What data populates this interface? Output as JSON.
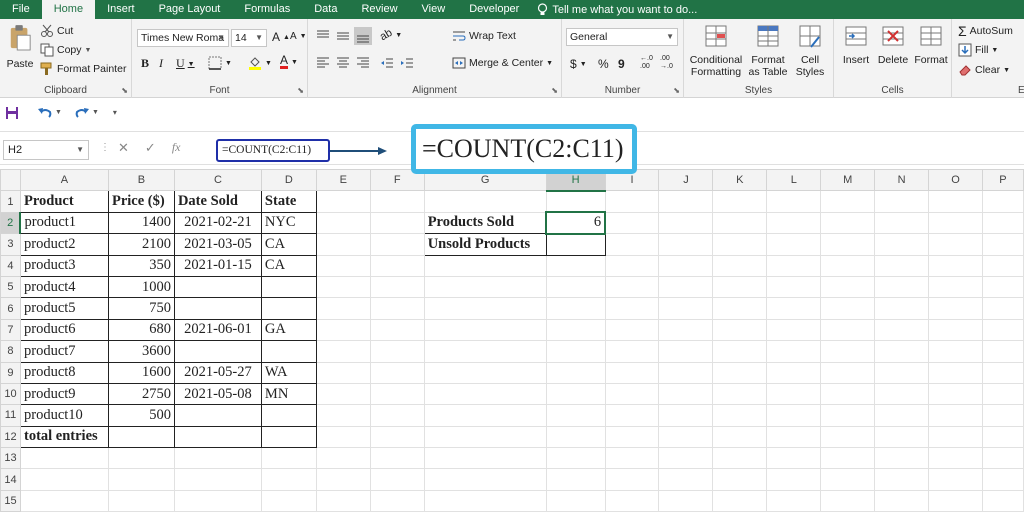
{
  "menu": {
    "tabs": [
      "File",
      "Home",
      "Insert",
      "Page Layout",
      "Formulas",
      "Data",
      "Review",
      "View",
      "Developer"
    ],
    "active": "Home",
    "tell_me": "Tell me what you want to do..."
  },
  "ribbon": {
    "clipboard": {
      "label": "Clipboard",
      "paste": "Paste",
      "cut": "Cut",
      "copy": "Copy",
      "format_painter": "Format Painter"
    },
    "font": {
      "label": "Font",
      "font_name": "Times New Roma",
      "font_size": "14",
      "bold": "B",
      "italic": "I",
      "underline": "U"
    },
    "alignment": {
      "label": "Alignment",
      "wrap_text": "Wrap Text",
      "merge_center": "Merge & Center"
    },
    "number": {
      "label": "Number",
      "format": "General",
      "currency": "$",
      "percent": "%",
      "comma": "9"
    },
    "styles": {
      "label": "Styles",
      "conditional_formatting": "Conditional Formatting",
      "format_as_table": "Format as Table",
      "cell_styles": "Cell Styles"
    },
    "cells": {
      "label": "Cells",
      "insert": "Insert",
      "delete": "Delete",
      "format": "Format"
    },
    "editing": {
      "label": "Ed",
      "autosum": "AutoSum",
      "fill": "Fill",
      "clear": "Clear"
    }
  },
  "formula_bar": {
    "name_box": "H2",
    "formula": "=COUNT(C2:C11)",
    "callout": "=COUNT(C2:C11)"
  },
  "sheet": {
    "columns": [
      "A",
      "B",
      "C",
      "D",
      "E",
      "F",
      "G",
      "H",
      "I",
      "J",
      "K",
      "L",
      "M",
      "N",
      "O",
      "P"
    ],
    "selected_column": "H",
    "selected_row": 2,
    "rows": [
      [
        "Product",
        "Price ($)",
        "Date Sold",
        "State",
        "",
        "",
        "",
        ""
      ],
      [
        "product1",
        "1400",
        "2021-02-21",
        "NYC",
        "",
        "",
        "Products Sold",
        "6"
      ],
      [
        "product2",
        "2100",
        "2021-03-05",
        "CA",
        "",
        "",
        "Unsold Products",
        ""
      ],
      [
        "product3",
        "350",
        "2021-01-15",
        "CA",
        "",
        "",
        "",
        ""
      ],
      [
        "product4",
        "1000",
        "",
        "",
        "",
        "",
        "",
        ""
      ],
      [
        "product5",
        "750",
        "",
        "",
        "",
        "",
        "",
        ""
      ],
      [
        "product6",
        "680",
        "2021-06-01",
        "GA",
        "",
        "",
        "",
        ""
      ],
      [
        "product7",
        "3600",
        "",
        "",
        "",
        "",
        "",
        ""
      ],
      [
        "product8",
        "1600",
        "2021-05-27",
        "WA",
        "",
        "",
        "",
        ""
      ],
      [
        "product9",
        "2750",
        "2021-05-08",
        "MN",
        "",
        "",
        "",
        ""
      ],
      [
        "product10",
        "500",
        "",
        "",
        "",
        "",
        "",
        ""
      ],
      [
        "total entries",
        "",
        "",
        "",
        "",
        "",
        "",
        ""
      ],
      [
        "",
        "",
        "",
        "",
        "",
        "",
        "",
        ""
      ],
      [
        "",
        "",
        "",
        "",
        "",
        "",
        "",
        ""
      ],
      [
        "",
        "",
        "",
        "",
        "",
        "",
        "",
        ""
      ]
    ]
  }
}
